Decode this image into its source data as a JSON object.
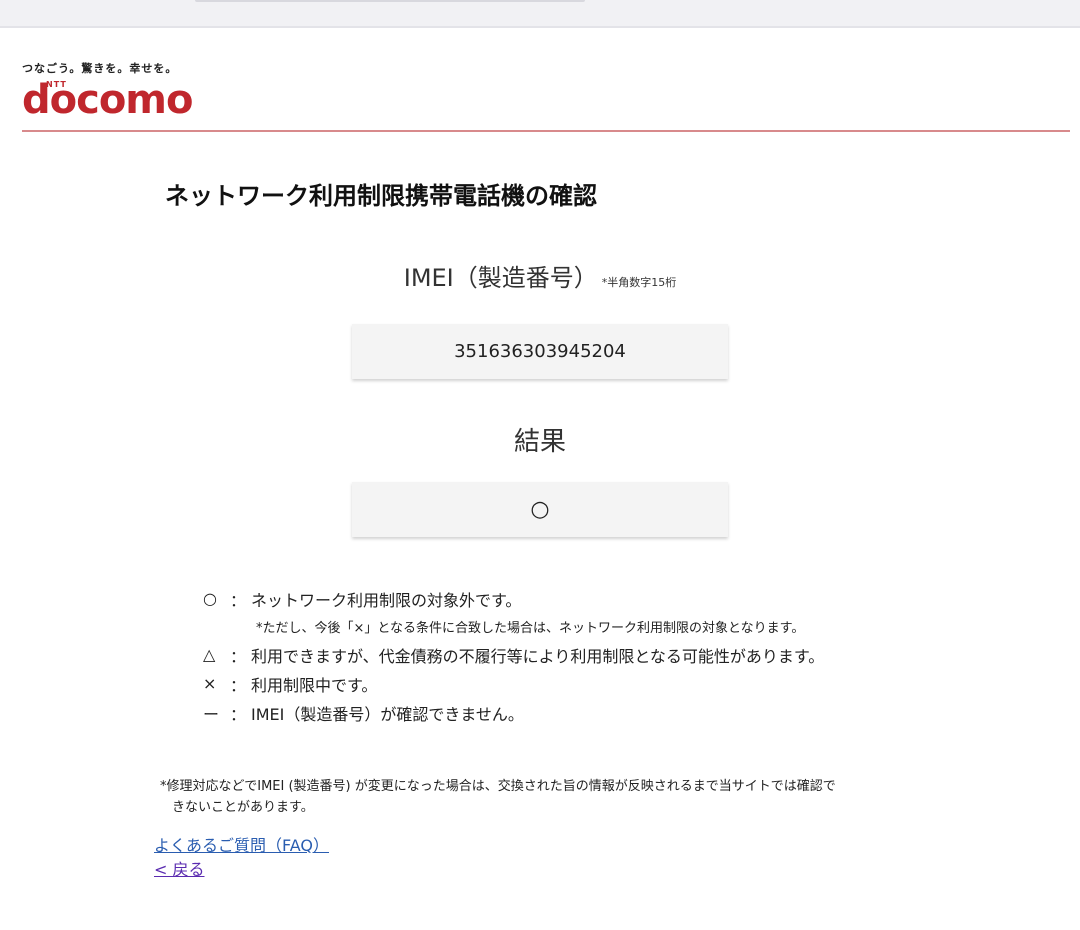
{
  "header": {
    "tagline": "つなごう。驚きを。幸せを。",
    "logo_ntt": "NTT",
    "logo_word": "docomo",
    "brand_color": "#c0272d"
  },
  "page": {
    "title": "ネットワーク利用制限携帯電話機の確認"
  },
  "imei": {
    "label": "IMEI（製造番号）",
    "note": "*半角数字15桁",
    "value": "351636303945204"
  },
  "result": {
    "label": "結果",
    "value": "○"
  },
  "legend": {
    "items": [
      {
        "symbol": "○",
        "colon": "：",
        "text": "ネットワーク利用制限の対象外です。"
      },
      {
        "symbol": "△",
        "colon": "：",
        "text": "利用できますが、代金債務の不履行等により利用制限となる可能性があります。"
      },
      {
        "symbol": "×",
        "colon": "：",
        "text": "利用制限中です。"
      },
      {
        "symbol": "ー",
        "colon": "：",
        "text": "IMEI（製造番号）が確認できません。"
      }
    ],
    "subnote": "*ただし、今後「×」となる条件に合致した場合は、ネットワーク利用制限の対象となります。"
  },
  "footnote": {
    "line1": "*修理対応などでIMEI (製造番号) が変更になった場合は、交換された旨の情報が反映されるまで当サイトでは確認で",
    "line2": "きないことがあります。"
  },
  "links": {
    "faq": "よくあるご質問（FAQ）",
    "back": "< 戻る"
  }
}
